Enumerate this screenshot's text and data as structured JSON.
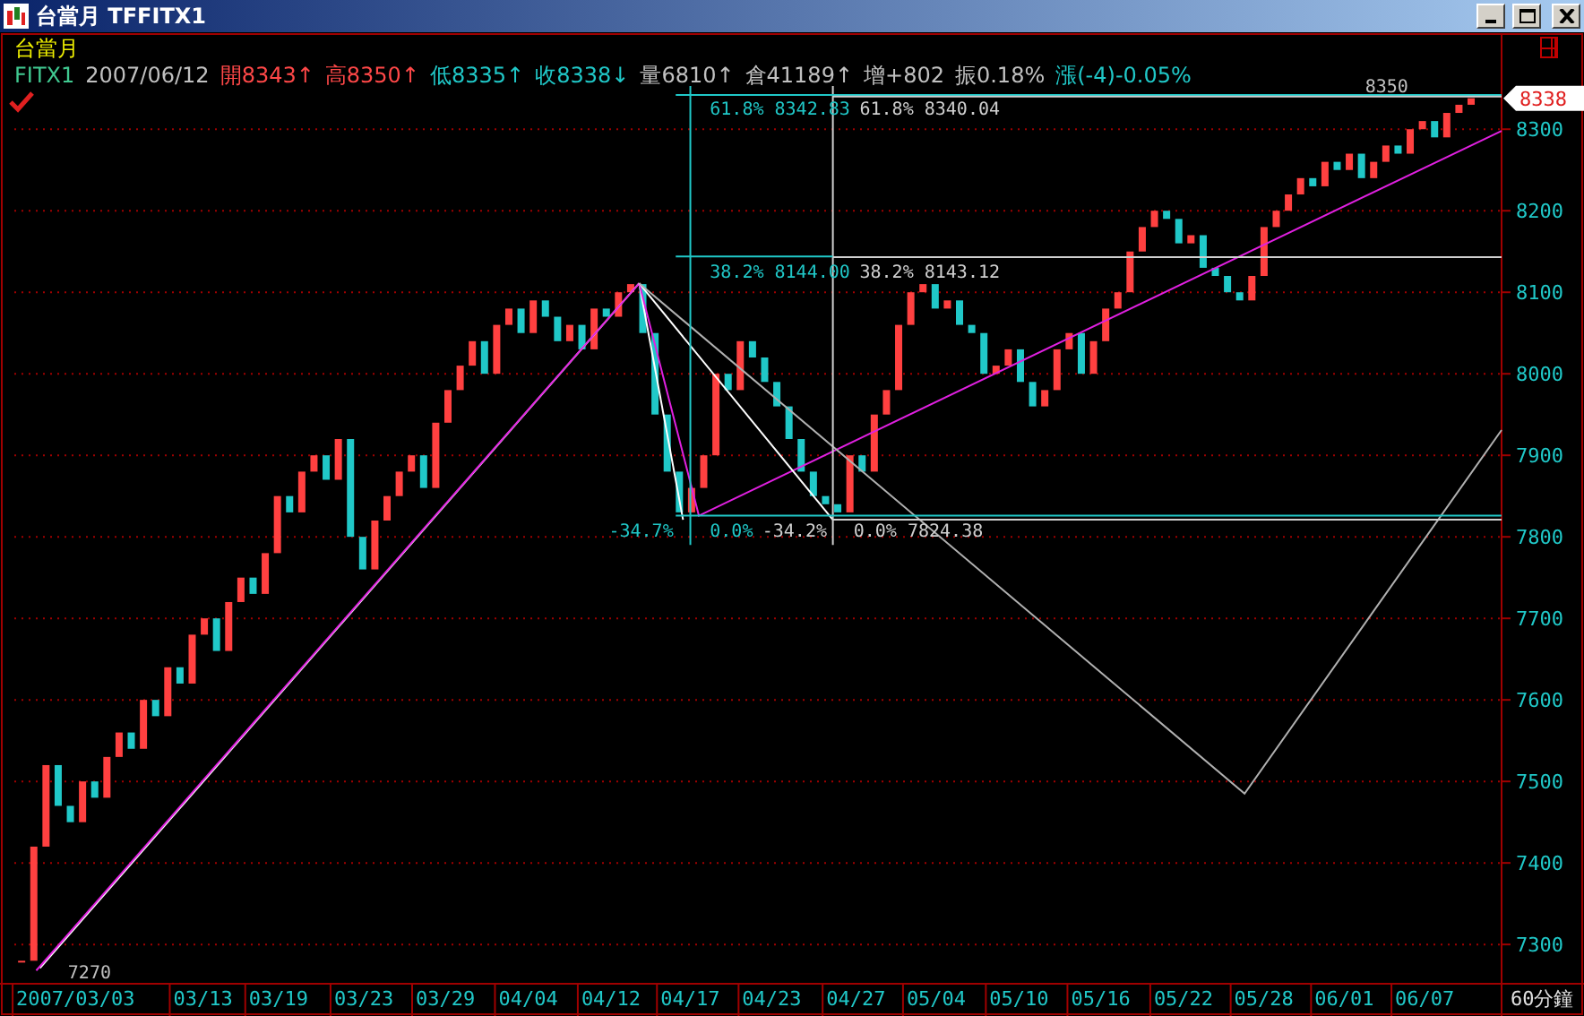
{
  "window": {
    "title": "台當月 TFFITX1"
  },
  "header": {
    "name": "台當月",
    "quote": [
      {
        "text": "FITX1",
        "color": "#40c890"
      },
      {
        "text": "2007/06/12",
        "color": "#c0c0c0"
      },
      {
        "text": "開8343↑",
        "color": "#ff4848"
      },
      {
        "text": "高8350↑",
        "color": "#ff4848"
      },
      {
        "text": "低8335↑",
        "color": "#20c8c8"
      },
      {
        "text": "收8338↓",
        "color": "#20c8c8"
      },
      {
        "text": "量6810↑",
        "color": "#c0c0c0"
      },
      {
        "text": "倉41189↑",
        "color": "#c0c0c0"
      },
      {
        "text": "增+802",
        "color": "#c0c0c0"
      },
      {
        "text": "振0.18%",
        "color": "#c0c0c0"
      },
      {
        "text": "漲(-4)-0.05%",
        "color": "#20c8c8"
      }
    ]
  },
  "price_axis": {
    "labels": [
      "8300",
      "8200",
      "8100",
      "8000",
      "7900",
      "7800",
      "7700",
      "7600",
      "7500",
      "7400",
      "7300"
    ],
    "last_price": "8338"
  },
  "date_axis": {
    "labels": [
      "2007/03/03",
      "03/13",
      "03/19",
      "03/23",
      "03/29",
      "04/04",
      "04/12",
      "04/17",
      "04/23",
      "04/27",
      "05/04",
      "05/10",
      "05/16",
      "05/22",
      "05/28",
      "06/01",
      "06/07"
    ],
    "period": "60分鐘"
  },
  "chart_labels": [
    "8350",
    "7270",
    "61.8% 8342.83",
    "61.8% 8340.04",
    "38.2% 8144.00",
    "38.2% 8143.12",
    "-34.7%",
    "0.0%",
    "-34.2%",
    "0.0% 7824.38"
  ]
}
